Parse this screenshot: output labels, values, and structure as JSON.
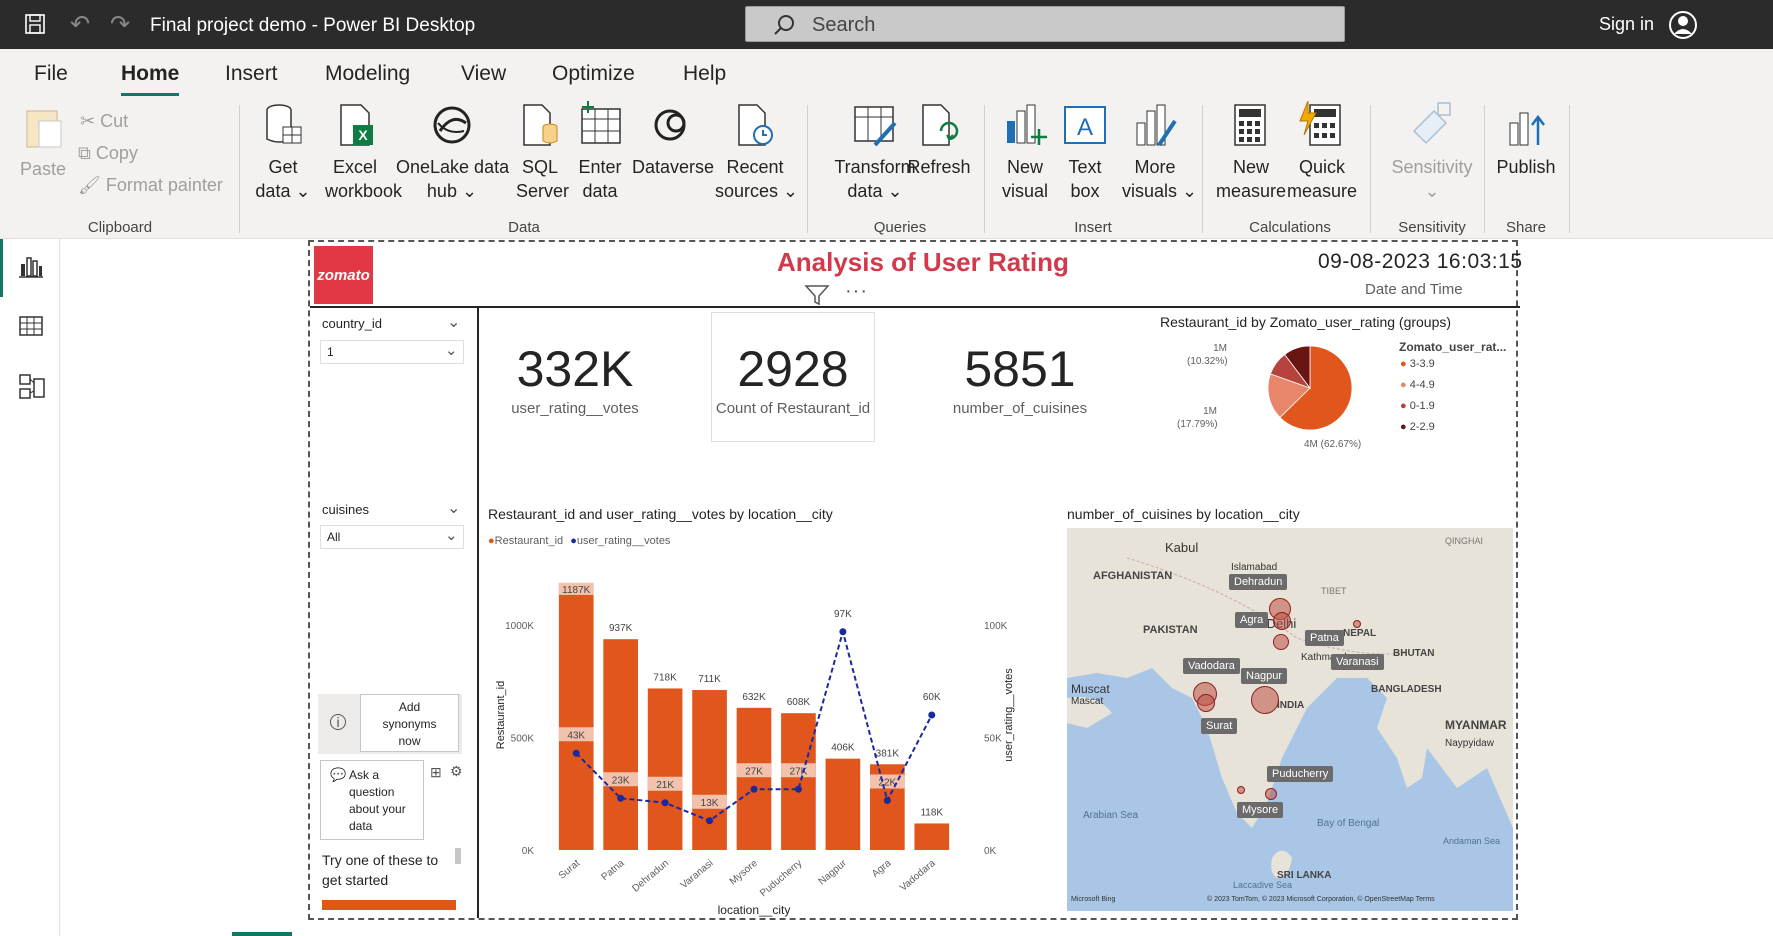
{
  "window": {
    "title": "Final project demo - Power BI Desktop",
    "search_placeholder": "Search",
    "sign_in": "Sign in"
  },
  "menu": [
    "File",
    "Home",
    "Insert",
    "Modeling",
    "View",
    "Optimize",
    "Help"
  ],
  "ribbon": {
    "clipboard": {
      "paste": "Paste",
      "cut": "Cut",
      "copy": "Copy",
      "format_painter": "Format painter",
      "group": "Clipboard"
    },
    "data": {
      "get_data": [
        "Get",
        "data"
      ],
      "excel": [
        "Excel",
        "workbook"
      ],
      "onelake": [
        "OneLake data",
        "hub"
      ],
      "sql": [
        "SQL",
        "Server"
      ],
      "enter": [
        "Enter",
        "data"
      ],
      "dataverse": "Dataverse",
      "recent": [
        "Recent",
        "sources"
      ],
      "group": "Data"
    },
    "queries": {
      "transform": [
        "Transform",
        "data"
      ],
      "refresh": "Refresh",
      "group": "Queries"
    },
    "insert": {
      "new_visual": [
        "New",
        "visual"
      ],
      "text_box": [
        "Text",
        "box"
      ],
      "more_visuals": [
        "More",
        "visuals"
      ],
      "group": "Insert"
    },
    "calculations": {
      "new_measure": [
        "New",
        "measure"
      ],
      "quick_measure": [
        "Quick",
        "measure"
      ],
      "group": "Calculations"
    },
    "sensitivity": {
      "label": "Sensitivity",
      "group": "Sensitivity"
    },
    "share": {
      "publish": "Publish",
      "group": "Share"
    }
  },
  "report": {
    "logo": "zomato",
    "title": "Analysis of User Rating",
    "datetime": "09-08-2023 16:03:15",
    "datetime_label": "Date and Time",
    "slicers": [
      {
        "field": "country_id",
        "value": "1"
      },
      {
        "field": "cuisines",
        "value": "All"
      }
    ],
    "qa": {
      "add_synonyms": [
        "Add",
        "synonyms",
        "now"
      ],
      "ask": [
        "Ask a",
        "question",
        "about your",
        "data"
      ],
      "hint": [
        "Try one of these to",
        "get started"
      ]
    },
    "kpis": [
      {
        "value": "332K",
        "label": "user_rating__votes"
      },
      {
        "value": "2928",
        "label": "Count of Restaurant_id"
      },
      {
        "value": "5851",
        "label": "number_of_cuisines"
      }
    ],
    "map": {
      "title": "number_of_cuisines by location__city",
      "countries": [
        "AFGHANISTAN",
        "PAKISTAN",
        "NEPAL",
        "BHUTAN",
        "BANGLADESH",
        "MYANMAR",
        "INDIA",
        "SRI LANKA",
        "TIBET",
        "QINGHAI"
      ],
      "places": [
        "Kabul",
        "Islamabad",
        "New Delhi",
        "Kathmandu",
        "Muscat",
        "Mascat",
        "Naypyidaw",
        "Arabian Sea",
        "Bay of Bengal",
        "Andaman Sea",
        "Laccadive Sea"
      ],
      "cities": [
        "Dehradun",
        "Agra",
        "Patna",
        "Varanasi",
        "Vadodara",
        "Nagpur",
        "Surat",
        "Puducherry",
        "Mysore"
      ],
      "attribution": "© 2023 TomTom, © 2023 Microsoft Corporation, © OpenStreetMap  Terms",
      "bing": "Microsoft Bing"
    }
  },
  "chart_data": [
    {
      "type": "pie",
      "title": "Restaurant_id by Zomato_user_rating (groups)",
      "legend_title": "Zomato_user_rat...",
      "legend_position": "right",
      "slices": [
        {
          "name": "3-3.9",
          "value": 62.67,
          "label": "4M (62.67%)",
          "color": "#e0561c"
        },
        {
          "name": "4-4.9",
          "value": 17.79,
          "label": "1M (17.79%)",
          "color": "#e8866c"
        },
        {
          "name": "0-1.9",
          "value": 9.22,
          "label": "",
          "color": "#b5433c"
        },
        {
          "name": "2-2.9",
          "value": 10.32,
          "label": "1M (10.32%)",
          "color": "#6b1414"
        }
      ]
    },
    {
      "type": "bar",
      "title": "Restaurant_id and user_rating__votes by location__city",
      "xlabel": "location__city",
      "ylabel": "Restaurant_id",
      "y2label": "user_rating__votes",
      "categories": [
        "Surat",
        "Patna",
        "Dehradun",
        "Varanasi",
        "Mysore",
        "Puducherry",
        "Nagpur",
        "Agra",
        "Vadodara"
      ],
      "ylim": [
        0,
        1200000
      ],
      "y_ticks": [
        "0K",
        "500K",
        "1000K"
      ],
      "y2lim": [
        0,
        120000
      ],
      "y2_ticks": [
        "0K",
        "50K",
        "100K"
      ],
      "series": [
        {
          "name": "Restaurant_id",
          "kind": "bar",
          "color": "#e0561c",
          "values": [
            1187000,
            937000,
            718000,
            711000,
            632000,
            608000,
            406000,
            381000,
            118000
          ],
          "labels": [
            "1187K",
            "937K",
            "718K",
            "711K",
            "632K",
            "608K",
            "406K",
            "381K",
            "118K"
          ]
        },
        {
          "name": "user_rating__votes",
          "kind": "line",
          "color": "#1a2a9c",
          "values": [
            43000,
            23000,
            21000,
            13000,
            27000,
            27000,
            97000,
            22000,
            60000
          ],
          "labels": [
            "43K",
            "23K",
            "21K",
            "13K",
            "27K",
            "27K",
            "97K",
            "22K",
            "60K"
          ]
        }
      ]
    }
  ]
}
